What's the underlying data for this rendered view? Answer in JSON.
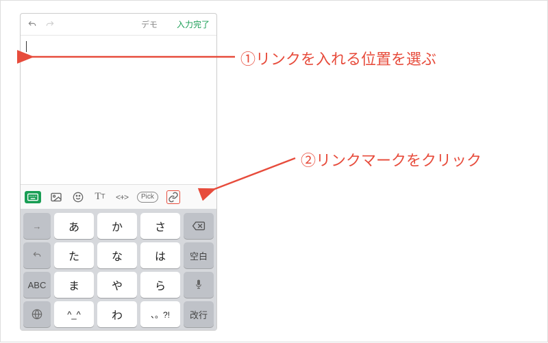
{
  "topbar": {
    "demo": "デモ",
    "done": "入力完了"
  },
  "actionbar": {
    "pick": "Pick"
  },
  "keys": {
    "row1": [
      "あ",
      "か",
      "さ"
    ],
    "row2": [
      "た",
      "な",
      "は"
    ],
    "row3": [
      "ま",
      "や",
      "ら"
    ],
    "row4": [
      "^_^",
      "わ",
      "、。?!"
    ],
    "space": "空白",
    "enter": "改行",
    "abc": "ABC",
    "arrow": "→"
  },
  "annot": {
    "a1": "①リンクを入れる位置を選ぶ",
    "a2": "②リンクマークをクリック"
  }
}
